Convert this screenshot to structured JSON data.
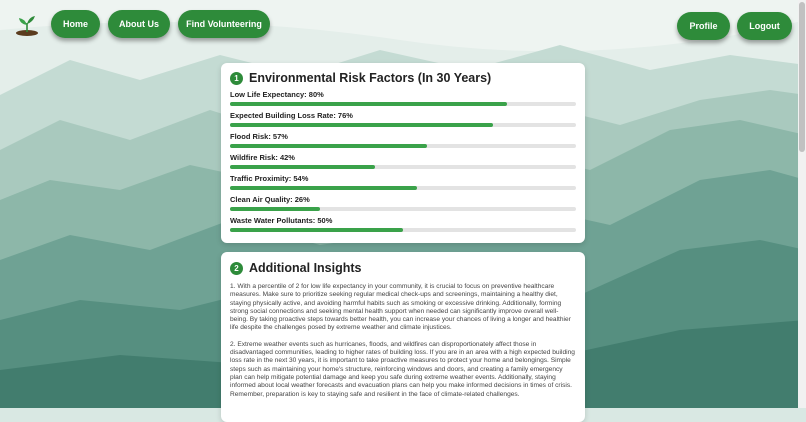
{
  "nav": {
    "home": "Home",
    "about": "About Us",
    "volunteer": "Find Volunteering",
    "profile": "Profile",
    "logout": "Logout"
  },
  "risk_card": {
    "number": "1",
    "title": "Environmental Risk Factors (In 30 Years)",
    "items": [
      {
        "label": "Low Life Expectancy: 80%",
        "value": 80
      },
      {
        "label": "Expected Building Loss Rate: 76%",
        "value": 76
      },
      {
        "label": "Flood Risk: 57%",
        "value": 57
      },
      {
        "label": "Wildfire Risk: 42%",
        "value": 42
      },
      {
        "label": "Traffic Proximity: 54%",
        "value": 54
      },
      {
        "label": "Clean Air Quality: 26%",
        "value": 26
      },
      {
        "label": "Waste Water Pollutants: 50%",
        "value": 50
      }
    ]
  },
  "insights_card": {
    "number": "2",
    "title": "Additional Insights",
    "paragraphs": [
      "1. With a percentile of 2 for low life expectancy in your community, it is crucial to focus on preventive healthcare measures. Make sure to prioritize seeking regular medical check-ups and screenings, maintaining a healthy diet, staying physically active, and avoiding harmful habits such as smoking or excessive drinking. Additionally, forming strong social connections and seeking mental health support when needed can significantly improve overall well-being. By taking proactive steps towards better health, you can increase your chances of living a longer and healthier life despite the challenges posed by extreme weather and climate injustices.",
      "2. Extreme weather events such as hurricanes, floods, and wildfires can disproportionately affect those in disadvantaged communities, leading to higher rates of building loss. If you are in an area with a high expected building loss rate in the next 30 years, it is important to take proactive measures to protect your home and belongings. Simple steps such as maintaining your home's structure, reinforcing windows and doors, and creating a family emergency plan can help mitigate potential damage and keep you safe during extreme weather events. Additionally, staying informed about local weather forecasts and evacuation plans can help you make informed decisions in times of crisis. Remember, preparation is key to staying safe and resilient in the face of climate-related challenges."
    ]
  },
  "colors": {
    "accent": "#2e8b3a",
    "bar_fill": "#3aa24a",
    "bar_track": "#e3e3e3"
  }
}
